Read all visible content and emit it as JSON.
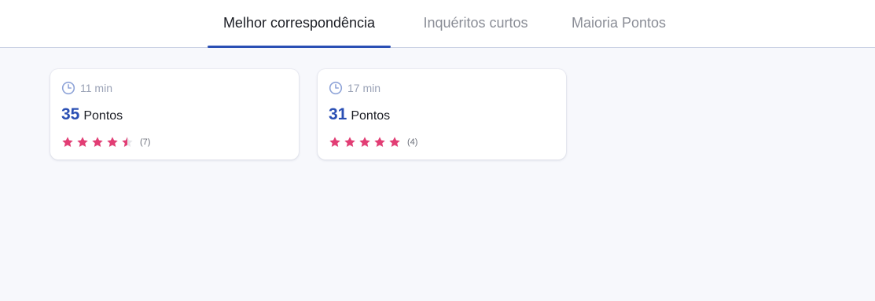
{
  "tabs": [
    {
      "label": "Melhor correspondência",
      "active": true
    },
    {
      "label": "Inquéritos curtos",
      "active": false
    },
    {
      "label": "Maioria Pontos",
      "active": false
    }
  ],
  "colors": {
    "accent": "#2a4fb4",
    "star": "#e23d74",
    "star_empty": "#e6e6ea",
    "clock": "#8fa4d8",
    "background": "#f7f8fc"
  },
  "cards": [
    {
      "time": "11 min",
      "points": "35",
      "points_label": "Pontos",
      "rating": 4.5,
      "rating_count": "(7)",
      "clock_icon": "clock-icon",
      "star_icon": "star-icon"
    },
    {
      "time": "17 min",
      "points": "31",
      "points_label": "Pontos",
      "rating": 5,
      "rating_count": "(4)",
      "clock_icon": "clock-icon",
      "star_icon": "star-icon"
    }
  ]
}
